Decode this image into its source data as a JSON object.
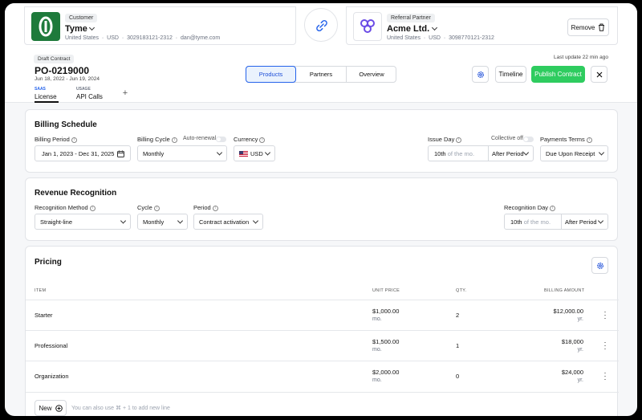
{
  "customer": {
    "tag": "Customer",
    "name": "Tyme",
    "country": "United States",
    "currency": "USD",
    "phone": "3029183121-2312",
    "email": "dan@tyme.com"
  },
  "partner": {
    "tag": "Referral Partner",
    "name": "Acme Ltd.",
    "country": "United States",
    "currency": "USD",
    "phone": "3098770121-2312",
    "remove_label": "Remove"
  },
  "contract": {
    "status": "Draft Contract",
    "id": "PO-0219000",
    "dates": "Jun 18, 2022 - Jun 19, 2024"
  },
  "product_tabs": [
    {
      "kicker": "SAAS",
      "label": "License"
    },
    {
      "kicker": "USAGE",
      "label": "API Calls"
    }
  ],
  "view_tabs": [
    "Products",
    "Partners",
    "Overview"
  ],
  "actions": {
    "last_update": "Last update 22 min ago",
    "timeline": "Timeline",
    "publish": "Publish Contract"
  },
  "billing": {
    "title": "Billing Schedule",
    "period_label": "Billing Period",
    "period_value": "Jan 1, 2023 - Dec 31, 2025",
    "cycle_label": "Billing Cycle",
    "auto_renewal": "Auto-renewal",
    "cycle_value": "Monthly",
    "currency_label": "Currency",
    "currency_value": "USD",
    "issue_label": "Issue Day",
    "collective": "Collective off",
    "issue_day": "10th",
    "issue_suffix": "of the mo.",
    "issue_when": "After Period",
    "terms_label": "Payments Terms",
    "terms_value": "Due Upon Receipt"
  },
  "revenue": {
    "title": "Revenue Recognition",
    "method_label": "Recognition Method",
    "method_value": "Straight-line",
    "cycle_label": "Cycle",
    "cycle_value": "Monthly",
    "period_label": "Period",
    "period_value": "Contract activation",
    "day_label": "Recognition Day",
    "day_value": "10th",
    "day_suffix": "of the mo.",
    "day_when": "After Period"
  },
  "pricing": {
    "title": "Pricing",
    "headers": [
      "ITEM",
      "UNIT PRICE",
      "QTY.",
      "BILLING AMOUNT"
    ],
    "rows": [
      {
        "item": "Starter",
        "price": "$1,000.00",
        "price_unit": "mo.",
        "qty": "2",
        "amount": "$12,000.00",
        "amount_unit": "yr."
      },
      {
        "item": "Professional",
        "price": "$1,500.00",
        "price_unit": "mo.",
        "qty": "1",
        "amount": "$18,000",
        "amount_unit": "yr."
      },
      {
        "item": "Organization",
        "price": "$2,000.00",
        "price_unit": "mo.",
        "qty": "0",
        "amount": "$24,000",
        "amount_unit": "yr."
      }
    ],
    "new_label": "New",
    "hint": "You can also use ⌘ + 1 to add new line"
  },
  "colors": {
    "brand_green": "#1e7a3b",
    "publish_green": "#2ecc5f",
    "link_blue": "#2563eb",
    "partner_purple": "#6b4ce6"
  }
}
